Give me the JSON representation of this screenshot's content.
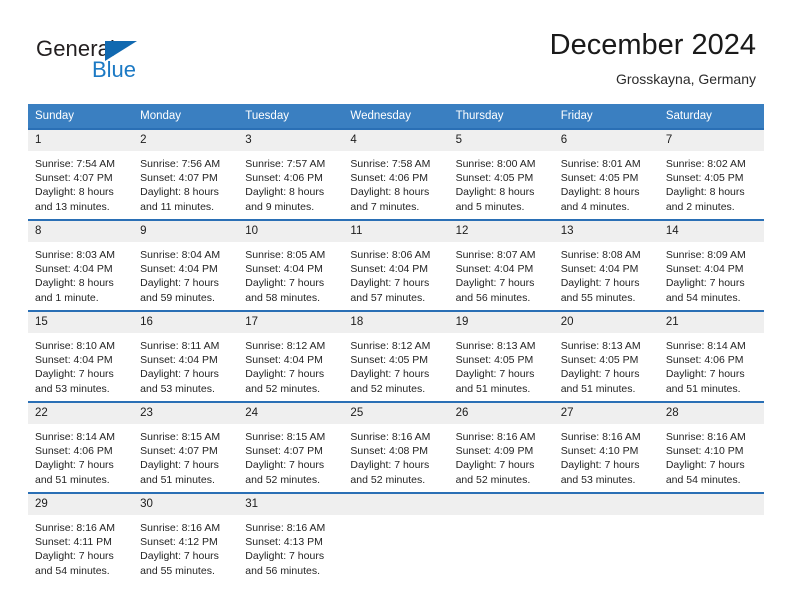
{
  "brand": {
    "name_part1": "General",
    "name_part2": "Blue",
    "triangle_color": "#1169b0",
    "blue_color": "#1b79c4"
  },
  "header": {
    "title": "December 2024",
    "subtitle": "Grosskayna, Germany"
  },
  "theme": {
    "header_bg": "#3a7fc1",
    "row_border": "#2a6fb5",
    "daynum_bg": "#efefef",
    "text": "#242424"
  },
  "weekday_headers": [
    "Sunday",
    "Monday",
    "Tuesday",
    "Wednesday",
    "Thursday",
    "Friday",
    "Saturday"
  ],
  "labels": {
    "sunrise_prefix": "Sunrise:",
    "sunset_prefix": "Sunset:",
    "daylight_prefix": "Daylight:"
  },
  "weeks": [
    [
      {
        "day": "1",
        "sunrise": "Sunrise: 7:54 AM",
        "sunset": "Sunset: 4:07 PM",
        "daylight1": "Daylight: 8 hours",
        "daylight2": "and 13 minutes."
      },
      {
        "day": "2",
        "sunrise": "Sunrise: 7:56 AM",
        "sunset": "Sunset: 4:07 PM",
        "daylight1": "Daylight: 8 hours",
        "daylight2": "and 11 minutes."
      },
      {
        "day": "3",
        "sunrise": "Sunrise: 7:57 AM",
        "sunset": "Sunset: 4:06 PM",
        "daylight1": "Daylight: 8 hours",
        "daylight2": "and 9 minutes."
      },
      {
        "day": "4",
        "sunrise": "Sunrise: 7:58 AM",
        "sunset": "Sunset: 4:06 PM",
        "daylight1": "Daylight: 8 hours",
        "daylight2": "and 7 minutes."
      },
      {
        "day": "5",
        "sunrise": "Sunrise: 8:00 AM",
        "sunset": "Sunset: 4:05 PM",
        "daylight1": "Daylight: 8 hours",
        "daylight2": "and 5 minutes."
      },
      {
        "day": "6",
        "sunrise": "Sunrise: 8:01 AM",
        "sunset": "Sunset: 4:05 PM",
        "daylight1": "Daylight: 8 hours",
        "daylight2": "and 4 minutes."
      },
      {
        "day": "7",
        "sunrise": "Sunrise: 8:02 AM",
        "sunset": "Sunset: 4:05 PM",
        "daylight1": "Daylight: 8 hours",
        "daylight2": "and 2 minutes."
      }
    ],
    [
      {
        "day": "8",
        "sunrise": "Sunrise: 8:03 AM",
        "sunset": "Sunset: 4:04 PM",
        "daylight1": "Daylight: 8 hours",
        "daylight2": "and 1 minute."
      },
      {
        "day": "9",
        "sunrise": "Sunrise: 8:04 AM",
        "sunset": "Sunset: 4:04 PM",
        "daylight1": "Daylight: 7 hours",
        "daylight2": "and 59 minutes."
      },
      {
        "day": "10",
        "sunrise": "Sunrise: 8:05 AM",
        "sunset": "Sunset: 4:04 PM",
        "daylight1": "Daylight: 7 hours",
        "daylight2": "and 58 minutes."
      },
      {
        "day": "11",
        "sunrise": "Sunrise: 8:06 AM",
        "sunset": "Sunset: 4:04 PM",
        "daylight1": "Daylight: 7 hours",
        "daylight2": "and 57 minutes."
      },
      {
        "day": "12",
        "sunrise": "Sunrise: 8:07 AM",
        "sunset": "Sunset: 4:04 PM",
        "daylight1": "Daylight: 7 hours",
        "daylight2": "and 56 minutes."
      },
      {
        "day": "13",
        "sunrise": "Sunrise: 8:08 AM",
        "sunset": "Sunset: 4:04 PM",
        "daylight1": "Daylight: 7 hours",
        "daylight2": "and 55 minutes."
      },
      {
        "day": "14",
        "sunrise": "Sunrise: 8:09 AM",
        "sunset": "Sunset: 4:04 PM",
        "daylight1": "Daylight: 7 hours",
        "daylight2": "and 54 minutes."
      }
    ],
    [
      {
        "day": "15",
        "sunrise": "Sunrise: 8:10 AM",
        "sunset": "Sunset: 4:04 PM",
        "daylight1": "Daylight: 7 hours",
        "daylight2": "and 53 minutes."
      },
      {
        "day": "16",
        "sunrise": "Sunrise: 8:11 AM",
        "sunset": "Sunset: 4:04 PM",
        "daylight1": "Daylight: 7 hours",
        "daylight2": "and 53 minutes."
      },
      {
        "day": "17",
        "sunrise": "Sunrise: 8:12 AM",
        "sunset": "Sunset: 4:04 PM",
        "daylight1": "Daylight: 7 hours",
        "daylight2": "and 52 minutes."
      },
      {
        "day": "18",
        "sunrise": "Sunrise: 8:12 AM",
        "sunset": "Sunset: 4:05 PM",
        "daylight1": "Daylight: 7 hours",
        "daylight2": "and 52 minutes."
      },
      {
        "day": "19",
        "sunrise": "Sunrise: 8:13 AM",
        "sunset": "Sunset: 4:05 PM",
        "daylight1": "Daylight: 7 hours",
        "daylight2": "and 51 minutes."
      },
      {
        "day": "20",
        "sunrise": "Sunrise: 8:13 AM",
        "sunset": "Sunset: 4:05 PM",
        "daylight1": "Daylight: 7 hours",
        "daylight2": "and 51 minutes."
      },
      {
        "day": "21",
        "sunrise": "Sunrise: 8:14 AM",
        "sunset": "Sunset: 4:06 PM",
        "daylight1": "Daylight: 7 hours",
        "daylight2": "and 51 minutes."
      }
    ],
    [
      {
        "day": "22",
        "sunrise": "Sunrise: 8:14 AM",
        "sunset": "Sunset: 4:06 PM",
        "daylight1": "Daylight: 7 hours",
        "daylight2": "and 51 minutes."
      },
      {
        "day": "23",
        "sunrise": "Sunrise: 8:15 AM",
        "sunset": "Sunset: 4:07 PM",
        "daylight1": "Daylight: 7 hours",
        "daylight2": "and 51 minutes."
      },
      {
        "day": "24",
        "sunrise": "Sunrise: 8:15 AM",
        "sunset": "Sunset: 4:07 PM",
        "daylight1": "Daylight: 7 hours",
        "daylight2": "and 52 minutes."
      },
      {
        "day": "25",
        "sunrise": "Sunrise: 8:16 AM",
        "sunset": "Sunset: 4:08 PM",
        "daylight1": "Daylight: 7 hours",
        "daylight2": "and 52 minutes."
      },
      {
        "day": "26",
        "sunrise": "Sunrise: 8:16 AM",
        "sunset": "Sunset: 4:09 PM",
        "daylight1": "Daylight: 7 hours",
        "daylight2": "and 52 minutes."
      },
      {
        "day": "27",
        "sunrise": "Sunrise: 8:16 AM",
        "sunset": "Sunset: 4:10 PM",
        "daylight1": "Daylight: 7 hours",
        "daylight2": "and 53 minutes."
      },
      {
        "day": "28",
        "sunrise": "Sunrise: 8:16 AM",
        "sunset": "Sunset: 4:10 PM",
        "daylight1": "Daylight: 7 hours",
        "daylight2": "and 54 minutes."
      }
    ],
    [
      {
        "day": "29",
        "sunrise": "Sunrise: 8:16 AM",
        "sunset": "Sunset: 4:11 PM",
        "daylight1": "Daylight: 7 hours",
        "daylight2": "and 54 minutes."
      },
      {
        "day": "30",
        "sunrise": "Sunrise: 8:16 AM",
        "sunset": "Sunset: 4:12 PM",
        "daylight1": "Daylight: 7 hours",
        "daylight2": "and 55 minutes."
      },
      {
        "day": "31",
        "sunrise": "Sunrise: 8:16 AM",
        "sunset": "Sunset: 4:13 PM",
        "daylight1": "Daylight: 7 hours",
        "daylight2": "and 56 minutes."
      },
      {
        "day": "",
        "sunrise": "",
        "sunset": "",
        "daylight1": "",
        "daylight2": ""
      },
      {
        "day": "",
        "sunrise": "",
        "sunset": "",
        "daylight1": "",
        "daylight2": ""
      },
      {
        "day": "",
        "sunrise": "",
        "sunset": "",
        "daylight1": "",
        "daylight2": ""
      },
      {
        "day": "",
        "sunrise": "",
        "sunset": "",
        "daylight1": "",
        "daylight2": ""
      }
    ]
  ]
}
